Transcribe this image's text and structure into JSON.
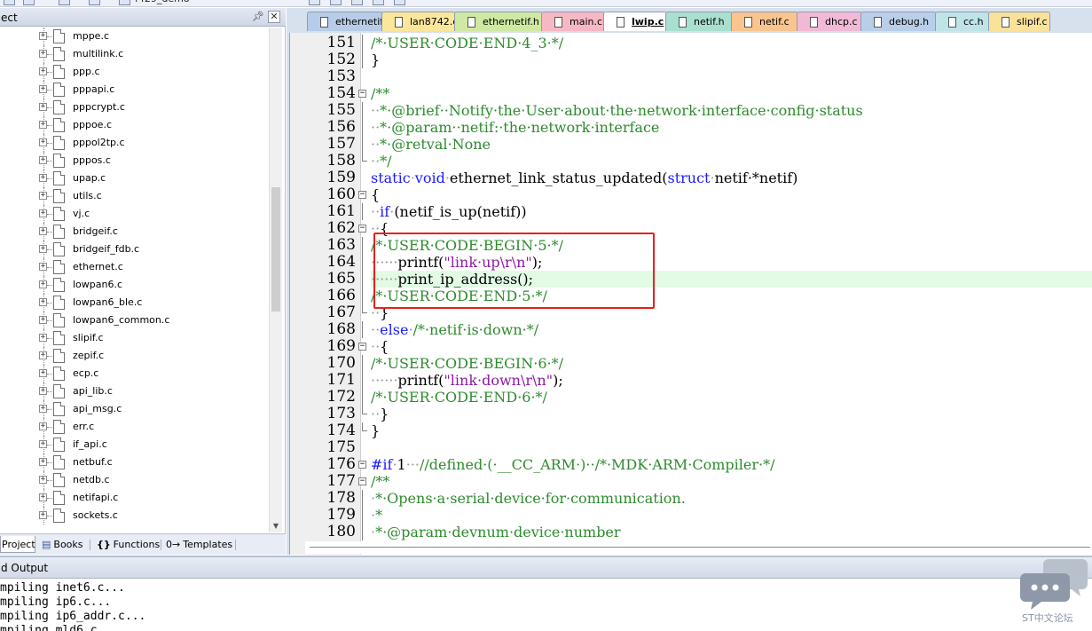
{
  "toolbar": {
    "project_name": "f429_demo"
  },
  "project_panel": {
    "title": "ect",
    "pin_icon": "pin-icon",
    "close_icon": "close-icon",
    "files": [
      "mppe.c",
      "multilink.c",
      "ppp.c",
      "pppapi.c",
      "pppcrypt.c",
      "pppoe.c",
      "pppol2tp.c",
      "pppos.c",
      "upap.c",
      "utils.c",
      "vj.c",
      "bridgeif.c",
      "bridgeif_fdb.c",
      "ethernet.c",
      "lowpan6.c",
      "lowpan6_ble.c",
      "lowpan6_common.c",
      "slipif.c",
      "zepif.c",
      "ecp.c",
      "api_lib.c",
      "api_msg.c",
      "err.c",
      "if_api.c",
      "netbuf.c",
      "netdb.c",
      "netifapi.c",
      "sockets.c"
    ],
    "tabs": [
      {
        "label": "Project",
        "icon": ""
      },
      {
        "label": "Books",
        "icon": "books-icon"
      },
      {
        "label": "Functions",
        "icon": "braces-icon"
      },
      {
        "label": "Templates",
        "icon": "template-icon"
      }
    ],
    "tab_glyphs": {
      "books": "▤",
      "functions": "{}",
      "templates": "0→"
    }
  },
  "editor": {
    "tabs": [
      {
        "label": "ethernetif.c",
        "color": "#b7cce8"
      },
      {
        "label": "lan8742.c",
        "color": "#fbe79b"
      },
      {
        "label": "ethernetif.h",
        "color": "#cfe9a3"
      },
      {
        "label": "main.c",
        "color": "#f6b8c2"
      },
      {
        "label": "lwip.c",
        "color": "#ffffff",
        "active": true
      },
      {
        "label": "netif.h",
        "color": "#a9dfcf"
      },
      {
        "label": "netif.c",
        "color": "#f9c48e"
      },
      {
        "label": "dhcp.c",
        "color": "#f1b9d6"
      },
      {
        "label": "debug.h",
        "color": "#b9cfe9"
      },
      {
        "label": "cc.h",
        "color": "#bfe4e8"
      },
      {
        "label": "slipif.c",
        "color": "#fbe29a"
      }
    ],
    "lines": [
      {
        "n": "151",
        "fold": "line",
        "parts": [
          [
            "c",
            "/*·USER·CODE·END·4_3·*/"
          ]
        ]
      },
      {
        "n": "152",
        "fold": "line",
        "parts": [
          [
            "p",
            "}"
          ]
        ]
      },
      {
        "n": "153",
        "fold": "",
        "parts": []
      },
      {
        "n": "154",
        "fold": "minus",
        "parts": [
          [
            "c",
            "/**"
          ]
        ]
      },
      {
        "n": "155",
        "fold": "line",
        "parts": [
          [
            "d",
            "··"
          ],
          [
            "c",
            "*·@brief··Notify·the·User·about·the·network·interface·config·status"
          ]
        ]
      },
      {
        "n": "156",
        "fold": "line",
        "parts": [
          [
            "d",
            "··"
          ],
          [
            "c",
            "*·@param··netif:·the·network·interface"
          ]
        ]
      },
      {
        "n": "157",
        "fold": "line",
        "parts": [
          [
            "d",
            "··"
          ],
          [
            "c",
            "*·@retval·None"
          ]
        ]
      },
      {
        "n": "158",
        "fold": "end",
        "parts": [
          [
            "d",
            "··"
          ],
          [
            "c",
            "*/"
          ]
        ]
      },
      {
        "n": "159",
        "fold": "",
        "parts": [
          [
            "k",
            "static"
          ],
          [
            "d",
            "·"
          ],
          [
            "k",
            "void"
          ],
          [
            "d",
            "·"
          ],
          [
            "p",
            "ethernet_link_status_updated("
          ],
          [
            "k",
            "struct"
          ],
          [
            "d",
            "·"
          ],
          [
            "p",
            "netif·*netif)"
          ]
        ]
      },
      {
        "n": "160",
        "fold": "minus",
        "parts": [
          [
            "p",
            "{"
          ]
        ]
      },
      {
        "n": "161",
        "fold": "line",
        "parts": [
          [
            "d",
            "··"
          ],
          [
            "k",
            "if"
          ],
          [
            "d",
            "·"
          ],
          [
            "p",
            "(netif_is_up(netif))"
          ]
        ]
      },
      {
        "n": "162",
        "fold": "minus",
        "parts": [
          [
            "d",
            "··"
          ],
          [
            "p",
            "{"
          ]
        ]
      },
      {
        "n": "163",
        "fold": "line",
        "parts": [
          [
            "c",
            "/*·USER·CODE·BEGIN·5·*/"
          ]
        ]
      },
      {
        "n": "164",
        "fold": "line",
        "parts": [
          [
            "d",
            "······"
          ],
          [
            "p",
            "printf("
          ],
          [
            "s",
            "\"link·up\\r\\n\""
          ],
          [
            "p",
            ");"
          ]
        ]
      },
      {
        "n": "165",
        "fold": "line",
        "highlight": true,
        "parts": [
          [
            "d",
            "······"
          ],
          [
            "p",
            "print_ip_address();"
          ]
        ]
      },
      {
        "n": "166",
        "fold": "line",
        "parts": [
          [
            "c",
            "/*·USER·CODE·END·5·*/"
          ]
        ]
      },
      {
        "n": "167",
        "fold": "end",
        "parts": [
          [
            "d",
            "··"
          ],
          [
            "p",
            "}"
          ]
        ]
      },
      {
        "n": "168",
        "fold": "line",
        "parts": [
          [
            "d",
            "··"
          ],
          [
            "k",
            "else"
          ],
          [
            "d",
            "·"
          ],
          [
            "c",
            "/*·netif·is·down·*/"
          ]
        ]
      },
      {
        "n": "169",
        "fold": "minus",
        "parts": [
          [
            "d",
            "··"
          ],
          [
            "p",
            "{"
          ]
        ]
      },
      {
        "n": "170",
        "fold": "line",
        "parts": [
          [
            "c",
            "/*·USER·CODE·BEGIN·6·*/"
          ]
        ]
      },
      {
        "n": "171",
        "fold": "line",
        "parts": [
          [
            "d",
            "······"
          ],
          [
            "p",
            "printf("
          ],
          [
            "s",
            "\"link·down\\r\\n\""
          ],
          [
            "p",
            ");"
          ]
        ]
      },
      {
        "n": "172",
        "fold": "line",
        "parts": [
          [
            "c",
            "/*·USER·CODE·END·6·*/"
          ]
        ]
      },
      {
        "n": "173",
        "fold": "end",
        "parts": [
          [
            "d",
            "··"
          ],
          [
            "p",
            "}"
          ]
        ]
      },
      {
        "n": "174",
        "fold": "end",
        "parts": [
          [
            "p",
            "}"
          ]
        ]
      },
      {
        "n": "175",
        "fold": "",
        "parts": []
      },
      {
        "n": "176",
        "fold": "minus",
        "parts": [
          [
            "k",
            "#if"
          ],
          [
            "d",
            "·"
          ],
          [
            "p",
            "1"
          ],
          [
            "d",
            "···"
          ],
          [
            "c",
            "//defined·(·__CC_ARM·)··/*·MDK·ARM·Compiler·*/"
          ]
        ]
      },
      {
        "n": "177",
        "fold": "minus",
        "parts": [
          [
            "c",
            "/**"
          ]
        ]
      },
      {
        "n": "178",
        "fold": "line",
        "parts": [
          [
            "d",
            "·"
          ],
          [
            "c",
            "*·Opens·a·serial·device·for·communication."
          ]
        ]
      },
      {
        "n": "179",
        "fold": "line",
        "parts": [
          [
            "d",
            "·"
          ],
          [
            "c",
            "*"
          ]
        ]
      },
      {
        "n": "180",
        "fold": "line",
        "parts": [
          [
            "d",
            "·"
          ],
          [
            "c",
            "*·@param·devnum·device·number"
          ]
        ]
      }
    ]
  },
  "output": {
    "title": "d Output",
    "lines": [
      "mpiling inet6.c...",
      "mpiling ip6.c...",
      "mpiling ip6_addr.c...",
      "mpiling mld6.c..."
    ]
  },
  "watermark": {
    "text": "ST中文论坛",
    "icon": "chat-bubbles-icon"
  }
}
